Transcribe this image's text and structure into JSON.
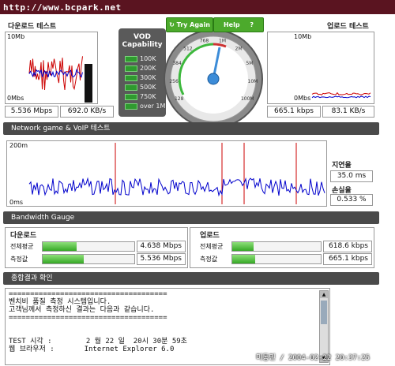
{
  "watermark": "http://www.bcpark.net",
  "download_test": {
    "title": "다운로드 테스트",
    "y_top": "10Mb",
    "y_bottom": "0Mbs",
    "mbps": "5.536 Mbps",
    "kbs": "692.0 KB/s"
  },
  "upload_test": {
    "title": "업로드 테스트",
    "y_top": "10Mb",
    "y_bottom": "0Mbs",
    "kbps": "665.1 kbps",
    "kbs": "83.1 KB/s"
  },
  "vod": {
    "title_line1": "VOD",
    "title_line2": "Capability",
    "items": [
      "100K",
      "200K",
      "300K",
      "500K",
      "750K",
      "over 1M"
    ]
  },
  "speedometer": {
    "try_again": "Try Again",
    "help": "Help",
    "help_icon": "?",
    "scale": [
      "128",
      "256",
      "384",
      "512",
      "768",
      "1M",
      "2M",
      "5M",
      "10M",
      "100M"
    ]
  },
  "network": {
    "title": "Network game & VoIP 테스트",
    "y_top": "200m",
    "y_bottom": "0ms",
    "latency_label": "지연율",
    "latency_value": "35.0 ms",
    "loss_label": "손실율",
    "loss_value": "0.533 %"
  },
  "bandwidth": {
    "title": "Bandwidth Gauge",
    "download": {
      "title": "다운로드",
      "avg_label": "전체평균",
      "avg_value": "4.638 Mbps",
      "avg_fill": 0.37,
      "measured_label": "측정값",
      "measured_value": "5.536 Mbps",
      "measured_fill": 0.45
    },
    "upload": {
      "title": "업로드",
      "avg_label": "전체평균",
      "avg_value": "618.6 kbps",
      "avg_fill": 0.24,
      "measured_label": "측정값",
      "measured_value": "665.1 kbps",
      "measured_fill": 0.26
    }
  },
  "result": {
    "title": "종합결과 확인",
    "lines": [
      "=====================================",
      "벤치비 품질 측정 시스템입니다.",
      "고객님께서 측정하신 결과는 다음과 같습니다.",
      "=====================================",
      "",
      "",
      "TEST 시각 :        2 월 22 일  20시 30분 59초",
      "웹 브라우저 :       Internet Explorer 6.0"
    ]
  },
  "footer_stamp": "미동민 / 2004-02-22 20:37:25",
  "colors": {
    "dark_panel": "#4a4a4a",
    "green": "#35a825",
    "graph_red": "#cc0000",
    "graph_blue": "#0000cc"
  }
}
